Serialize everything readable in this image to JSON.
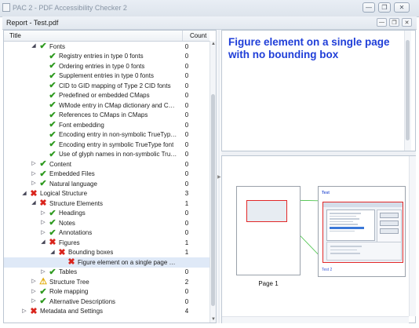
{
  "window": {
    "title": "PAC 2 - PDF Accessibility Checker 2",
    "minimize_icon": "minimize-icon",
    "restore_icon": "restore-icon",
    "close_icon": "close-icon"
  },
  "report": {
    "title": "Report - Test.pdf"
  },
  "tree": {
    "columns": {
      "title": "Title",
      "count": "Count"
    },
    "rows": [
      {
        "label": "Fonts",
        "count": "0",
        "status": "ok",
        "expand": "expanded",
        "level": 1
      },
      {
        "label": "Registry entries in type 0 fonts",
        "count": "0",
        "status": "ok",
        "expand": "none",
        "level": 2
      },
      {
        "label": "Ordering entries in type 0 fonts",
        "count": "0",
        "status": "ok",
        "expand": "none",
        "level": 2
      },
      {
        "label": "Supplement entries in type 0 fonts",
        "count": "0",
        "status": "ok",
        "expand": "none",
        "level": 2
      },
      {
        "label": "CID to GID mapping of Type 2 CID fonts",
        "count": "0",
        "status": "ok",
        "expand": "none",
        "level": 2
      },
      {
        "label": "Predefined or embedded CMaps",
        "count": "0",
        "status": "ok",
        "expand": "none",
        "level": 2
      },
      {
        "label": "WMode entry in CMap dictionary and CMap stream",
        "count": "0",
        "status": "ok",
        "expand": "none",
        "level": 2
      },
      {
        "label": "References to CMaps in CMaps",
        "count": "0",
        "status": "ok",
        "expand": "none",
        "level": 2
      },
      {
        "label": "Font embedding",
        "count": "0",
        "status": "ok",
        "expand": "none",
        "level": 2
      },
      {
        "label": "Encoding entry in non-symbolic TrueType font",
        "count": "0",
        "status": "ok",
        "expand": "none",
        "level": 2
      },
      {
        "label": "Encoding entry in symbolic TrueType font",
        "count": "0",
        "status": "ok",
        "expand": "none",
        "level": 2
      },
      {
        "label": "Use of glyph names in non-symbolic TrueType font",
        "count": "0",
        "status": "ok",
        "expand": "none",
        "level": 2
      },
      {
        "label": "Content",
        "count": "0",
        "status": "ok",
        "expand": "collapsed",
        "level": 1
      },
      {
        "label": "Embedded Files",
        "count": "0",
        "status": "ok",
        "expand": "collapsed",
        "level": 1
      },
      {
        "label": "Natural language",
        "count": "0",
        "status": "ok",
        "expand": "collapsed",
        "level": 1
      },
      {
        "label": "Logical Structure",
        "count": "3",
        "status": "err",
        "expand": "expanded",
        "level": 0
      },
      {
        "label": "Structure Elements",
        "count": "1",
        "status": "err",
        "expand": "expanded",
        "level": 1
      },
      {
        "label": "Headings",
        "count": "0",
        "status": "ok",
        "expand": "collapsed",
        "level": 2
      },
      {
        "label": "Notes",
        "count": "0",
        "status": "ok",
        "expand": "collapsed",
        "level": 2
      },
      {
        "label": "Annotations",
        "count": "0",
        "status": "ok",
        "expand": "collapsed",
        "level": 2
      },
      {
        "label": "Figures",
        "count": "1",
        "status": "err",
        "expand": "expanded",
        "level": 2
      },
      {
        "label": "Bounding boxes",
        "count": "1",
        "status": "err",
        "expand": "expanded",
        "level": 3
      },
      {
        "label": "Figure element on a single page with no bounding box",
        "count": "",
        "status": "err",
        "expand": "none",
        "level": 4,
        "selected": true
      },
      {
        "label": "Tables",
        "count": "0",
        "status": "ok",
        "expand": "collapsed",
        "level": 2
      },
      {
        "label": "Structure Tree",
        "count": "2",
        "status": "warn",
        "expand": "collapsed",
        "level": 1
      },
      {
        "label": "Role mapping",
        "count": "0",
        "status": "ok",
        "expand": "collapsed",
        "level": 1
      },
      {
        "label": "Alternative Descriptions",
        "count": "0",
        "status": "ok",
        "expand": "collapsed",
        "level": 1
      },
      {
        "label": "Metadata and Settings",
        "count": "4",
        "status": "err",
        "expand": "collapsed",
        "level": 0
      }
    ]
  },
  "detail": {
    "title": "Figure element on a single page with no bounding box"
  },
  "preview": {
    "page_label": "Page 1",
    "zoom_heading": "Test",
    "zoom_footer": "Test 2"
  },
  "colors": {
    "ok": "#2f9a20",
    "error": "#d9241c",
    "warning": "#e0a800",
    "detail_title": "#1f3ed8",
    "highlight": "#e22828"
  }
}
